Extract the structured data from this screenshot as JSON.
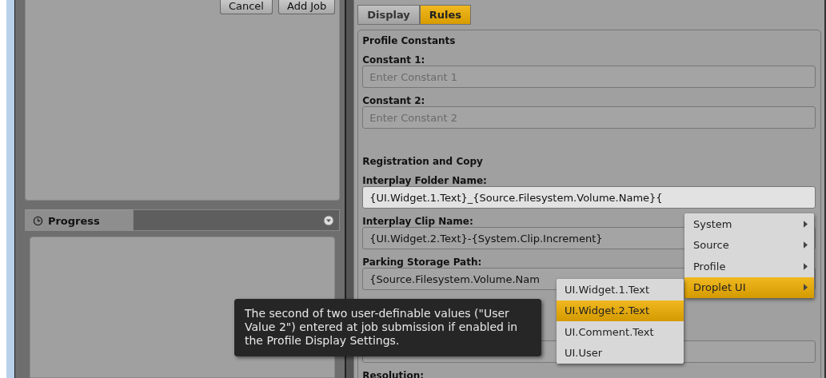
{
  "job_panel": {
    "buttons": [
      "Cancel",
      "Add Job"
    ]
  },
  "progress_panel": {
    "title": "Progress"
  },
  "tabs": [
    {
      "label": "Display",
      "selected": false
    },
    {
      "label": "Rules",
      "selected": true
    }
  ],
  "rules": {
    "sections": [
      {
        "heading": "Profile Constants",
        "fields": [
          {
            "label": "Constant 1:",
            "placeholder": "Enter Constant 1"
          },
          {
            "label": "Constant 2:",
            "placeholder": "Enter Constant 2"
          }
        ]
      },
      {
        "heading": "Registration and Copy",
        "fields": [
          {
            "label": "Interplay Folder Name:",
            "value": "{UI.Widget.1.Text}_{Source.Filesystem.Volume.Name}{",
            "focused": true
          },
          {
            "label": "Interplay Clip Name:",
            "value": "{UI.Widget.2.Text}-{System.Clip.Increment}",
            "focused": false
          },
          {
            "label": "Parking Storage Path:",
            "value": "{Source.Filesystem.Volume.Nam",
            "focused": false
          },
          {
            "kind": "box"
          },
          {
            "label": "Resolution:"
          }
        ]
      }
    ]
  },
  "context_menu": {
    "items": [
      {
        "label": "System",
        "selected": false
      },
      {
        "label": "Source",
        "selected": false
      },
      {
        "label": "Profile",
        "selected": false
      },
      {
        "label": "Droplet UI",
        "selected": true
      }
    ]
  },
  "submenu": {
    "items": [
      {
        "label": "UI.Widget.1.Text",
        "selected": false
      },
      {
        "label": "UI.Widget.2.Text",
        "selected": true
      },
      {
        "label": "UI.Comment.Text",
        "selected": false
      },
      {
        "label": "UI.User",
        "selected": false
      }
    ]
  },
  "tooltip": {
    "text": "The second of two user-definable values (\"User Value 2\") entered at job submission if enabled in the Profile Display Settings."
  }
}
